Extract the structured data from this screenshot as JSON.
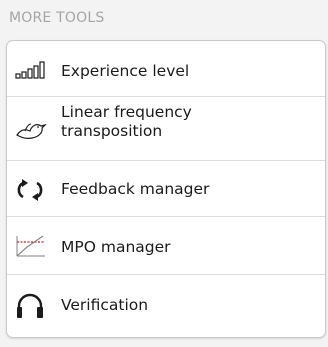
{
  "section": {
    "title": "MORE TOOLS"
  },
  "items": [
    {
      "label": "Experience level",
      "icon": "signal-bars-icon"
    },
    {
      "label": "Linear frequency\ntransposition",
      "icon": "bird-icon"
    },
    {
      "label": "Feedback manager",
      "icon": "refresh-arrows-icon"
    },
    {
      "label": "MPO manager",
      "icon": "mpo-graph-icon"
    },
    {
      "label": "Verification",
      "icon": "headphone-icon"
    }
  ],
  "colors": {
    "mpo_line": "#d21c1c",
    "icon": "#1b1b1b",
    "header": "#a5a5a5"
  }
}
